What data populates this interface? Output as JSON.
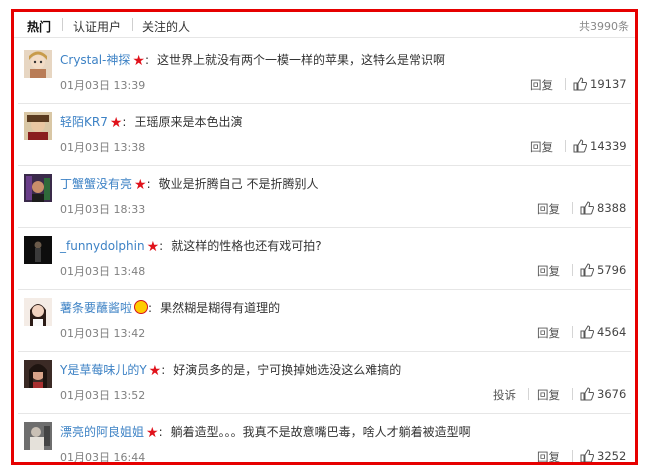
{
  "tabs": {
    "hot": "热门",
    "verified": "认证用户",
    "following": "关注的人",
    "total": "共3990条"
  },
  "actions": {
    "reply": "回复",
    "report": "投诉"
  },
  "colors": {
    "link": "#3d82c5",
    "border": "#e60000",
    "badge": "#e0121b"
  },
  "comments": [
    {
      "user": "Crystal-神探",
      "badge": "star-icon",
      "text": "这世界上就没有两个一模一样的苹果，这特么是常识啊",
      "time": "01月03日 13:39",
      "likes": "19137",
      "report": false
    },
    {
      "user": "轻陌KR7",
      "badge": "star-icon",
      "text": "王瑶原来是本色出演",
      "time": "01月03日 13:38",
      "likes": "14339",
      "report": false
    },
    {
      "user": "丁蟹蟹没有亮",
      "badge": "star-icon",
      "text": "敬业是折腾自己 不是折腾别人",
      "time": "01月03日 18:33",
      "likes": "8388",
      "report": false
    },
    {
      "user": "_funnydolphin",
      "badge": "star-icon",
      "text": "就这样的性格也还有戏可拍?",
      "time": "01月03日 13:48",
      "likes": "5796",
      "report": false
    },
    {
      "user": "薯条要蘸酱啦",
      "badge": "face-icon",
      "text": "果然糊是糊得有道理的",
      "time": "01月03日 13:42",
      "likes": "4564",
      "report": false
    },
    {
      "user": "Y是草莓味儿的Y",
      "badge": "star-icon",
      "text": "好演员多的是，宁可换掉她选没这么难搞的",
      "time": "01月03日 13:52",
      "likes": "3676",
      "report": true
    },
    {
      "user": "漂亮的阿良姐姐",
      "badge": "star-icon",
      "text": "躺着造型。。。我真不是故意嘴巴毒，啥人才躺着被造型啊",
      "time": "01月03日 16:44",
      "likes": "3252",
      "report": false
    }
  ]
}
